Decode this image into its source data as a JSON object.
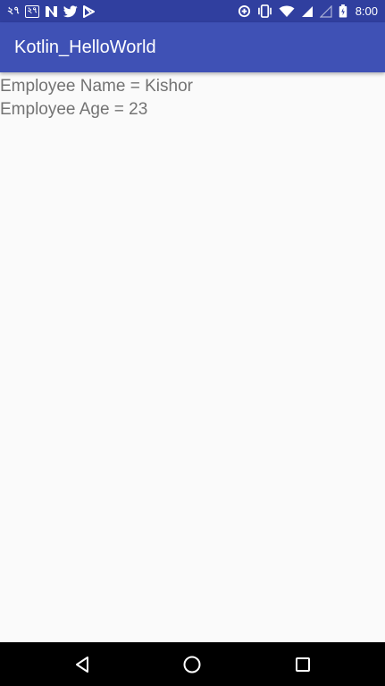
{
  "status_bar": {
    "left_icons": [
      {
        "name": "bengali-numeral-notification-icon",
        "text": "২৭"
      },
      {
        "name": "bengali-numeral-box-notification-icon",
        "text": "২৭"
      },
      {
        "name": "n-app-notification-icon"
      },
      {
        "name": "twitter-notification-icon"
      },
      {
        "name": "play-store-notification-icon"
      }
    ],
    "right_icons": [
      "data-saver-icon",
      "vibrate-icon",
      "wifi-icon",
      "cell-signal-icon",
      "cell-signal-empty-icon",
      "battery-icon"
    ],
    "time": "8:00"
  },
  "app_bar": {
    "title": "Kotlin_HelloWorld"
  },
  "content": {
    "lines": [
      "Employee Name = Kishor",
      "Employee Age = 23"
    ]
  },
  "nav_bar": {
    "buttons": [
      "back-icon",
      "home-icon",
      "recents-icon"
    ]
  },
  "colors": {
    "status_bar": "#303F9F",
    "app_bar": "#3F51B5",
    "background": "#FAFAFA",
    "body_text": "#737373",
    "nav_bar": "#000000"
  }
}
